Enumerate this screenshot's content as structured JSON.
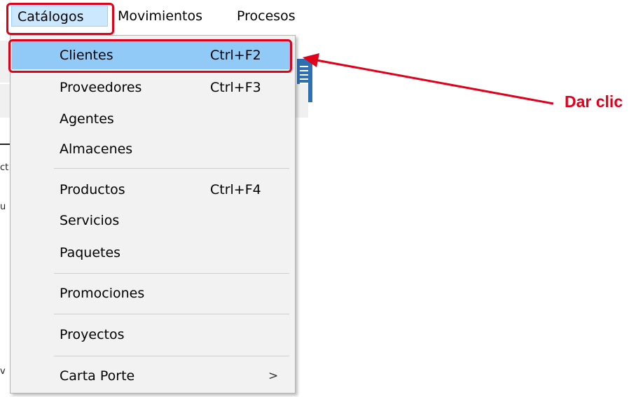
{
  "menubar": {
    "items": [
      {
        "label": "Catálogos"
      },
      {
        "label": "Movimientos"
      },
      {
        "label": "Procesos"
      }
    ]
  },
  "dropdown": {
    "items": [
      {
        "label": "Clientes",
        "shortcut": "Ctrl+F2",
        "selected": true
      },
      {
        "label": "Proveedores",
        "shortcut": "Ctrl+F3"
      },
      {
        "label": "Agentes",
        "shortcut": ""
      },
      {
        "label": "Almacenes",
        "shortcut": ""
      },
      {
        "label": "Productos",
        "shortcut": "Ctrl+F4"
      },
      {
        "label": "Servicios",
        "shortcut": ""
      },
      {
        "label": "Paquetes",
        "shortcut": ""
      },
      {
        "label": "Promociones",
        "shortcut": ""
      },
      {
        "label": "Proyectos",
        "shortcut": ""
      },
      {
        "label": "Carta Porte",
        "shortcut": "",
        "has_submenu": true
      }
    ],
    "submenu_arrow": ">"
  },
  "background": {
    "fragments": [
      "ct",
      "u",
      "v"
    ]
  },
  "annotation": {
    "text": "Dar clic",
    "color": "#e0001a"
  },
  "colors": {
    "menu_selected": "#91c9f7",
    "menubar_active": "#cce8ff",
    "highlight": "#e0001a"
  }
}
